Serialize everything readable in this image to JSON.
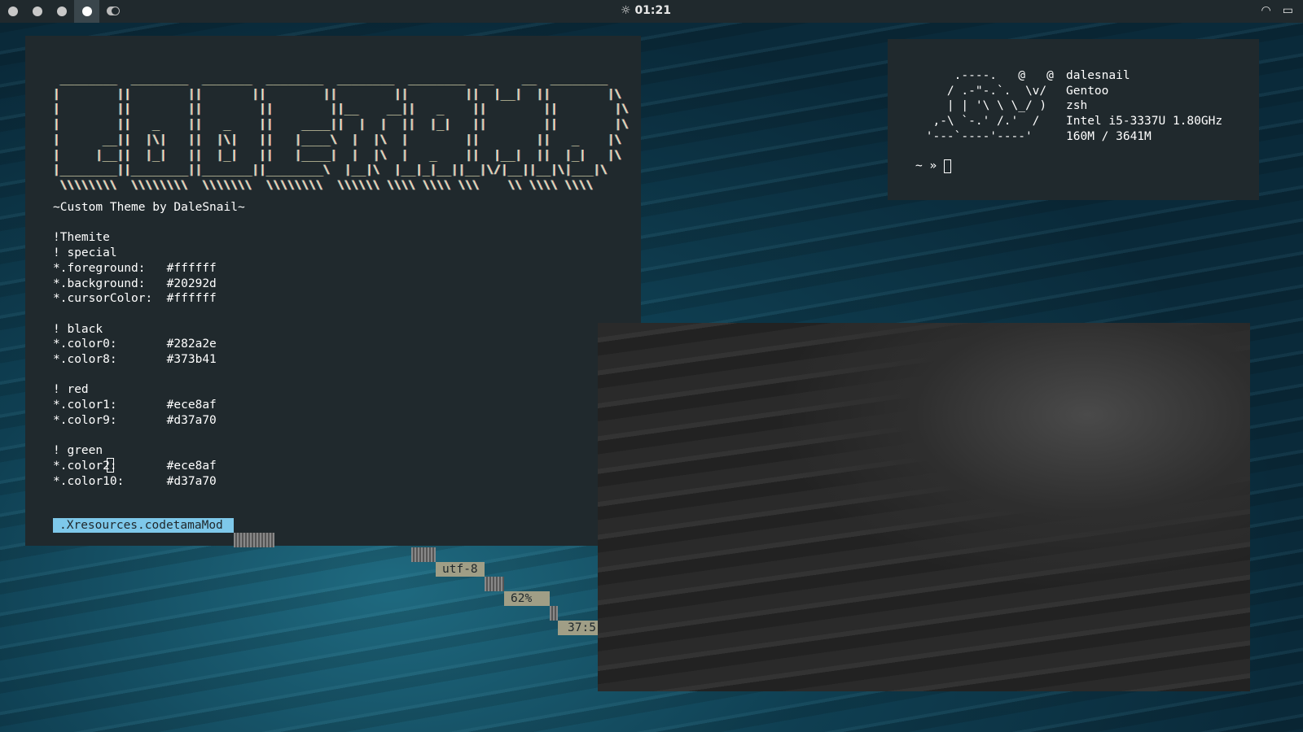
{
  "topbar": {
    "workspaces": [
      {
        "id": 1,
        "active": false
      },
      {
        "id": 2,
        "active": false
      },
      {
        "id": 3,
        "active": false
      },
      {
        "id": 4,
        "active": true
      }
    ],
    "clock": "01:21",
    "icons": [
      "toggle-icon",
      "sun-icon",
      "wifi-icon",
      "battery-icon"
    ]
  },
  "editor": {
    "banner": [
      " ________  ________  _______  ________  ________  ________  __    __  ________",
      "|        ||        ||       ||        ||        ||        ||  |__|  ||        |\\",
      "|        ||        ||        ||        ||__    __||   _    ||        ||        |\\",
      "|        ||   _    ||   _    ||    ____||  |  |  ||  |_|   ||        ||        |\\",
      "|      __||  |\\|   ||  |\\|   ||   |____\\  |  |\\  |        ||        ||   _    |\\",
      "|     |__||  |_|   ||  |_|   ||   |____|  |  |\\  |   _    ||  |__|  ||  |_|   |\\",
      "|________||________||_______||________\\  |__|\\  |__|_|__||__|\\/|__||__|\\|___|\\",
      " \\\\\\\\\\\\\\\\  \\\\\\\\\\\\\\\\  \\\\\\\\\\\\\\  \\\\\\\\\\\\\\\\  \\\\\\\\\\\\ \\\\\\\\ \\\\\\\\ \\\\\\    \\\\ \\\\\\\\ \\\\\\\\"
    ],
    "lines": [
      "~Custom Theme by DaleSnail~",
      "",
      "!Themite",
      "! special",
      "*.foreground:   #ffffff",
      "*.background:   #20292d",
      "*.cursorColor:  #ffffff",
      "",
      "! black",
      "*.color0:       #282a2e",
      "*.color8:       #373b41",
      "",
      "! red",
      "*.color1:       #ece8af",
      "*.color9:       #d37a70",
      "",
      "! green",
      "*.color2:       #ece8af",
      "*.color10:      #d37a70"
    ],
    "status": {
      "filename": ".Xresources.codetamaMod",
      "encoding": "utf-8",
      "percent": "62%",
      "position": "37:5"
    }
  },
  "neofetch": {
    "art": [
      "     .----.   @   @",
      "    / .-\"-.`.  \\v/",
      "    | | '\\ \\ \\_/ )",
      "  ,-\\ `-.' /.'  /",
      " '---`----'----'"
    ],
    "info": [
      "dalesnail",
      "Gentoo",
      "zsh",
      "Intel i5-3337U 1.80GHz",
      "160M / 3641M"
    ],
    "prompt": "~ »"
  },
  "colors": {
    "background": "#20292d",
    "foreground": "#ffffff",
    "accent": "#7ec8ea",
    "yellow": "#ece8af",
    "red": "#d37a70"
  }
}
